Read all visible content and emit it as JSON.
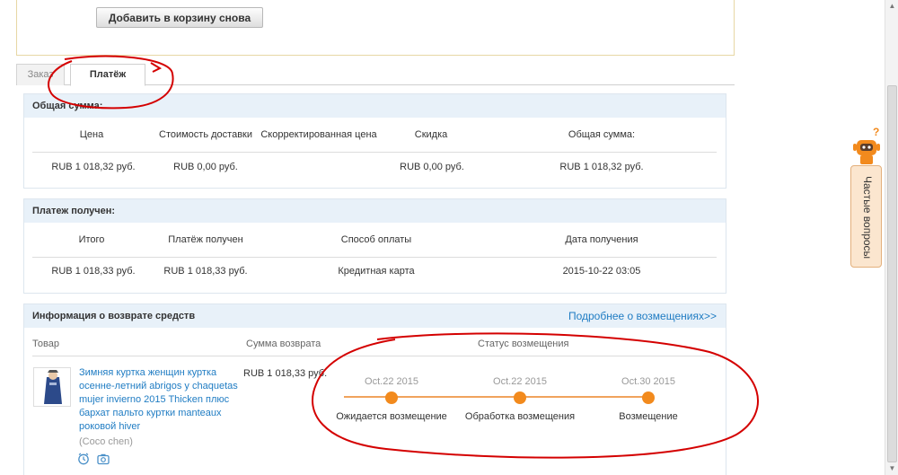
{
  "top": {
    "readd_button": "Добавить в корзину снова"
  },
  "tabs": [
    {
      "label": "Заказ"
    },
    {
      "label": "Платёж"
    }
  ],
  "total": {
    "title": "Общая сумма:",
    "headers": [
      "Цена",
      "Стоимость доставки",
      "Скорректированная цена",
      "Скидка",
      "Общая сумма:"
    ],
    "values": [
      "RUB 1 018,32 руб.",
      "RUB 0,00 руб.",
      "",
      "RUB 0,00 руб.",
      "RUB 1 018,32 руб."
    ]
  },
  "payment": {
    "title": "Платеж получен:",
    "headers": [
      "Итого",
      "Платёж получен",
      "Способ оплаты",
      "Дата получения"
    ],
    "values": [
      "RUB 1 018,33 руб.",
      "RUB 1 018,33 руб.",
      "Кредитная карта",
      "2015-10-22 03:05"
    ]
  },
  "refund": {
    "title": "Информация о возврате средств",
    "more_link": "Подробнее о возмещениях>>",
    "col_product": "Товар",
    "col_amount": "Сумма возврата",
    "col_status": "Статус возмещения",
    "product_title": "Зимняя куртка женщин куртка осенне-летний abrigos y chaquetas mujer invierno 2015 Thicken плюс бархат пальто куртки manteaux роковой hiver",
    "seller": "(Coco chen)",
    "amount": "RUB 1 018,33 руб.",
    "timeline": [
      {
        "date": "Oct.22 2015",
        "label": "Ожидается возмещение"
      },
      {
        "date": "Oct.22 2015",
        "label": "Обработка возмещения"
      },
      {
        "date": "Oct.30 2015",
        "label": "Возмещение"
      }
    ]
  },
  "faq": {
    "label": "Частые вопросы"
  },
  "colors": {
    "accent_orange": "#f28a1d",
    "link_blue": "#1f7cc3",
    "panel_head": "#e8f1f9",
    "annotation_red": "#d40000"
  }
}
